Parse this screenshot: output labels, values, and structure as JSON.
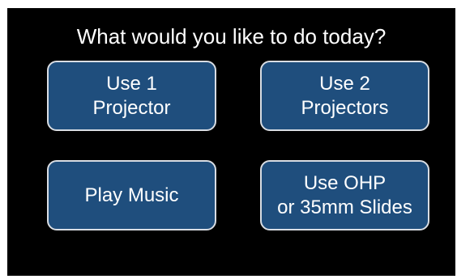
{
  "prompt": "What would you like to do today?",
  "buttons": [
    {
      "line1": "Use 1",
      "line2": "Projector"
    },
    {
      "line1": "Use 2",
      "line2": "Projectors"
    },
    {
      "line1": "Play Music",
      "line2": ""
    },
    {
      "line1": "Use OHP",
      "line2": "or 35mm Slides"
    }
  ],
  "colors": {
    "background": "#000000",
    "button_fill": "#1f4e7d",
    "button_border": "#d9dde3",
    "text": "#ffffff"
  }
}
